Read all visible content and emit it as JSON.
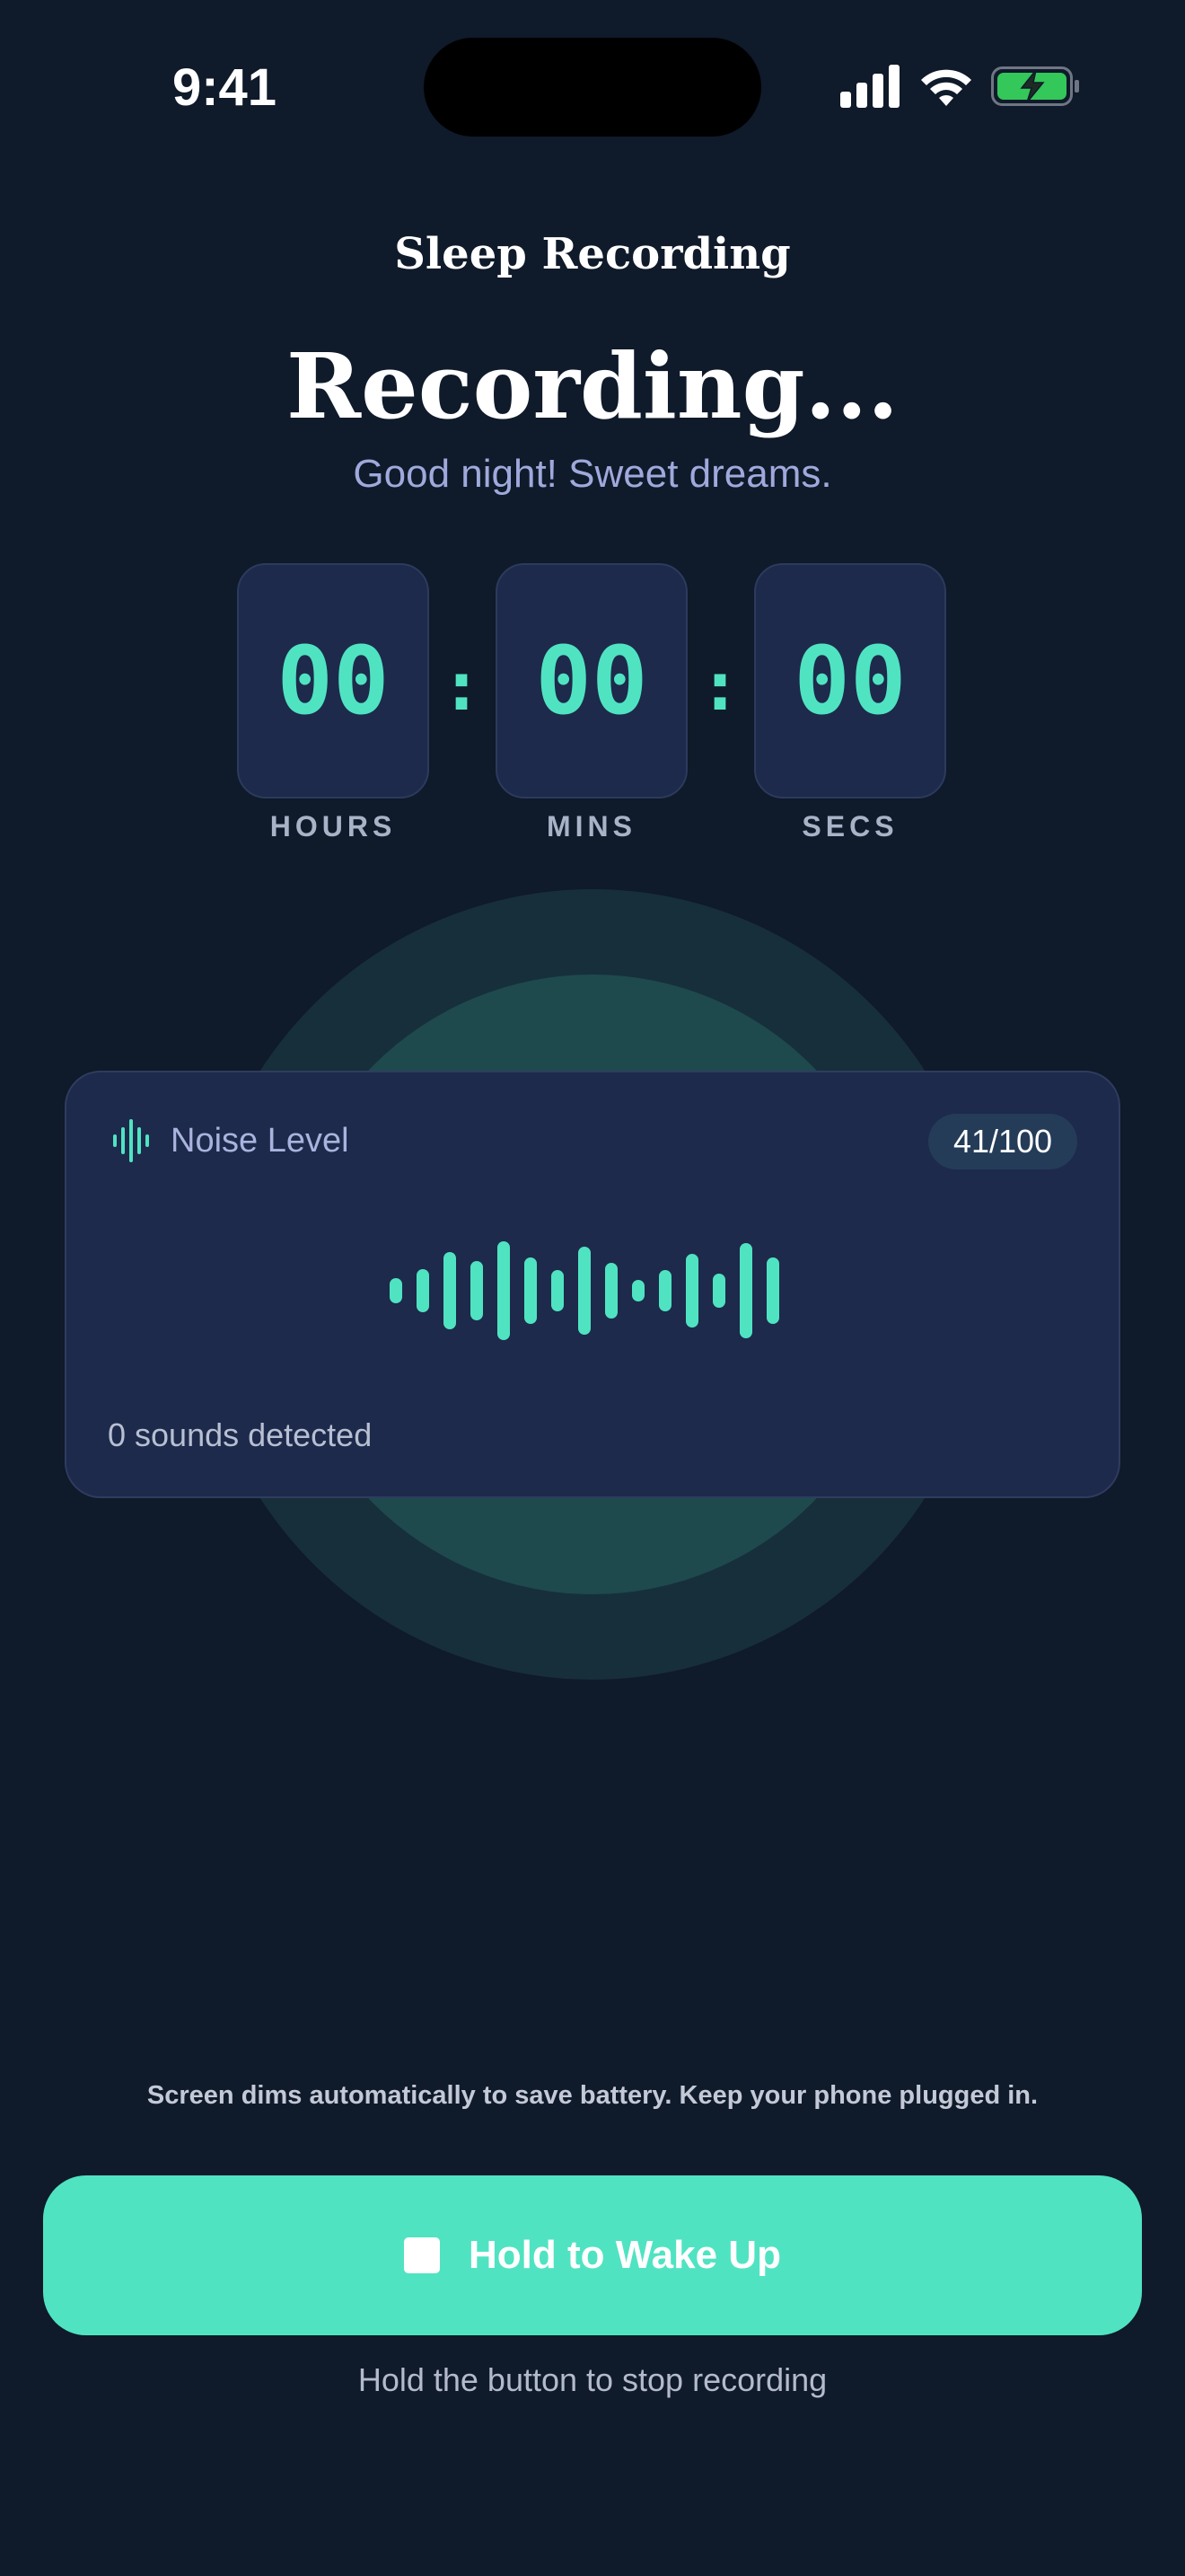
{
  "status_bar": {
    "time": "9:41",
    "icons": [
      "signal-icon",
      "wifi-icon",
      "battery-charging-icon"
    ]
  },
  "header": {
    "title": "Sleep Recording"
  },
  "hero": {
    "title": "Recording...",
    "subtitle": "Good night! Sweet dreams."
  },
  "timer": {
    "hours": "00",
    "mins": "00",
    "secs": "00",
    "separator": ":",
    "hours_label": "HOURS",
    "mins_label": "MINS",
    "secs_label": "SECS"
  },
  "noise": {
    "label": "Noise Level",
    "icon": "waveform-icon",
    "level": "41/100",
    "sounds": "0 sounds detected"
  },
  "footer": {
    "hint": "Screen dims automatically to save battery. Keep your phone plugged in.",
    "button_label": "Hold to Wake Up",
    "button_icon": "stop-icon",
    "note": "Hold the button to stop recording"
  },
  "colors": {
    "background": "#0f1a2a",
    "accent": "#50e3c2",
    "card": "#1d2a4b",
    "subtitle": "#9fa9dc"
  }
}
